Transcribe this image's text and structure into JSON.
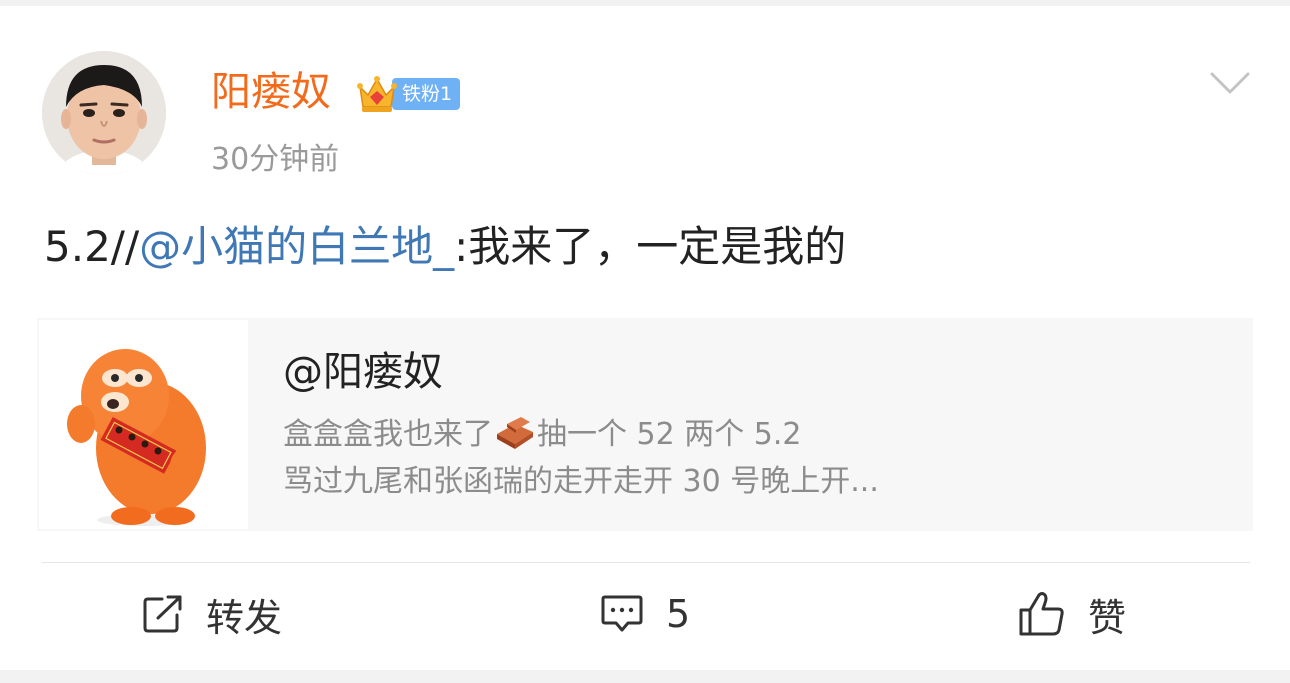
{
  "post": {
    "author": {
      "name": "阳瘘奴",
      "badge_label": "铁粉1"
    },
    "time": "30分钟前",
    "text": {
      "prefix": "5.2//",
      "mention": "@小猫的白兰地_",
      "suffix": ":我来了，一定是我的"
    },
    "quoted": {
      "author": "@阳瘘奴",
      "line1_before_emoji": "盒盒盒我也来了",
      "line1_after_emoji": "抽一个 52 两个 5.2",
      "line2": "骂过九尾和张函瑞的走开走开 30 号晚上开...",
      "emoji": "brick-emoji"
    }
  },
  "actions": {
    "repost_label": "转发",
    "comment_count": "5",
    "like_label": "赞"
  },
  "colors": {
    "username": "#f26b1d",
    "mention": "#3f78b4",
    "badge": "#6fb1f5",
    "quote_background": "#f7f7f7"
  },
  "icons": {
    "menu": "chevron-down-icon",
    "repost": "repost-icon",
    "comment": "comment-icon",
    "like": "thumbs-up-icon"
  }
}
